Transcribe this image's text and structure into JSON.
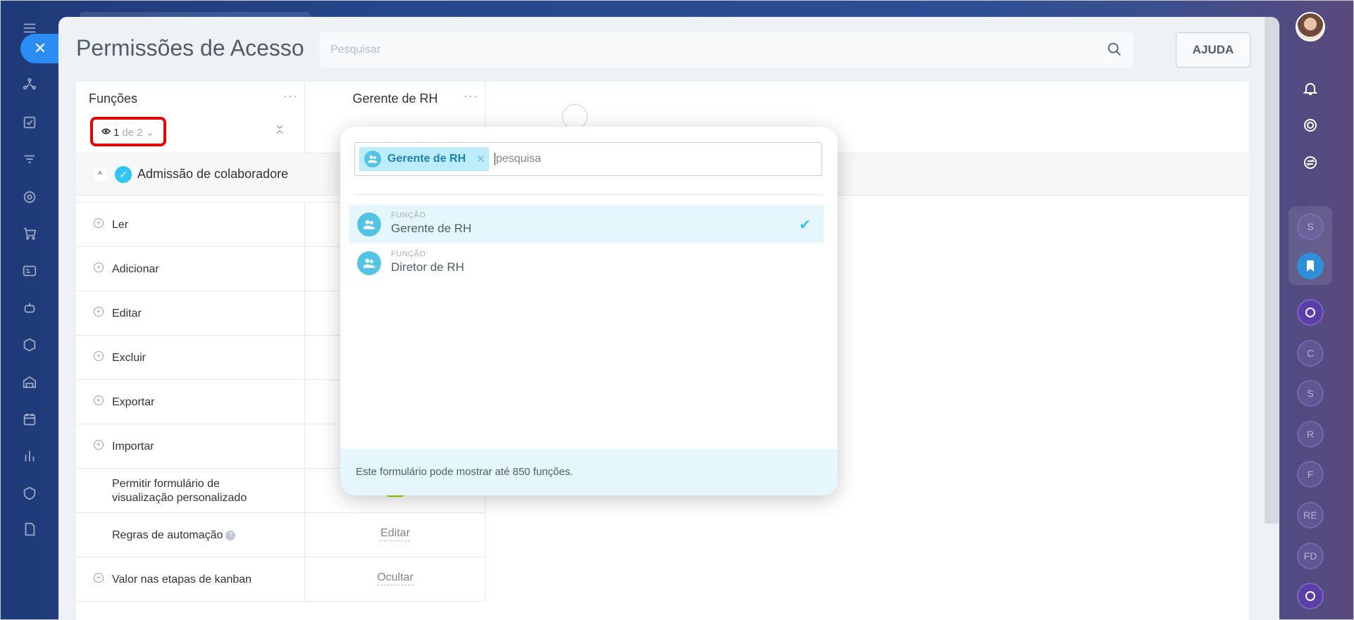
{
  "page": {
    "title": "Permissões de Acesso",
    "search_placeholder": "Pesquisar",
    "help_label": "AJUDA"
  },
  "left_nav": {
    "close_glyph": "✕",
    "icons": [
      "menu-icon",
      "integrations-icon",
      "tasks-icon",
      "filter-icon",
      "target-icon",
      "cart-icon",
      "contacts-icon",
      "robot-icon",
      "box-icon",
      "warehouse-icon",
      "calendar-icon",
      "chart-icon",
      "shield-icon",
      "document-icon"
    ]
  },
  "table": {
    "roles_header": "Funções",
    "visible_count": "1",
    "total_text": "de 2",
    "role_column": "Gerente de RH",
    "section_label": "Admissão de colaboradore",
    "rows": [
      {
        "label": "Ler",
        "expandable": true
      },
      {
        "label": "Adicionar",
        "expandable": true
      },
      {
        "label": "Editar",
        "expandable": true
      },
      {
        "label": "Excluir",
        "expandable": true
      },
      {
        "label": "Exportar",
        "expandable": true
      },
      {
        "label": "Importar",
        "expandable": true
      },
      {
        "label": "Permitir formulário de visualização personalizado",
        "expandable": false,
        "toggle_on": true
      },
      {
        "label": "Regras de automação",
        "expandable": false,
        "link": "Editar"
      },
      {
        "label": "Valor nas etapas de kanban",
        "expandable": true,
        "link": "Ocultar"
      }
    ]
  },
  "popup": {
    "selected_tag": "Gerente de RH",
    "input_placeholder": "pesquisa",
    "options": [
      {
        "caption": "FUNÇÃO",
        "name": "Gerente de RH",
        "selected": true
      },
      {
        "caption": "FUNÇÃO",
        "name": "Diretor de RH",
        "selected": false
      }
    ],
    "footer": "Este formulário pode mostrar até 850 funções."
  },
  "right_rail": {
    "avatars": [
      "S",
      "C",
      "S",
      "R",
      "F",
      "RE",
      "FD"
    ]
  },
  "colors": {
    "accent": "#2fc6f6",
    "close_button": "#2b8cf4",
    "toggle_on": "#9dcf00",
    "highlight_border": "#e30000"
  }
}
